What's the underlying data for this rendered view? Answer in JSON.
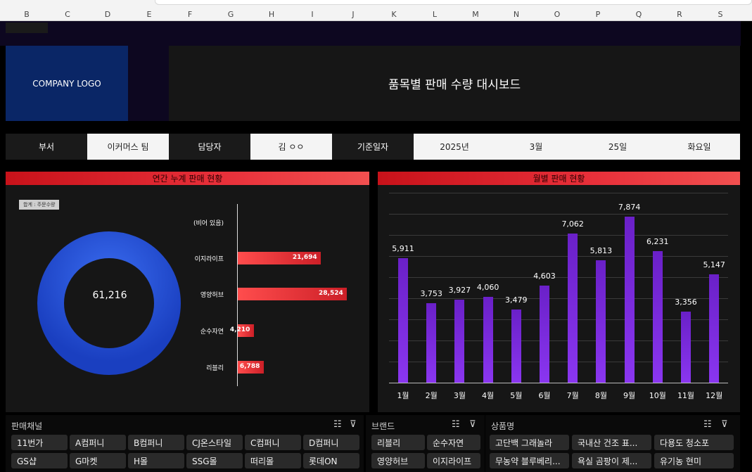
{
  "columns": [
    "B",
    "C",
    "D",
    "E",
    "F",
    "G",
    "H",
    "I",
    "J",
    "K",
    "L",
    "M",
    "N",
    "O",
    "P",
    "Q",
    "R",
    "S"
  ],
  "logo": "COMPANY LOGO",
  "title": "품목별 판매 수량 대시보드",
  "info": {
    "dept_label": "부서",
    "dept_value": "이커머스 팀",
    "owner_label": "담당자",
    "owner_value": "김 ㅇㅇ",
    "date_label": "기준일자",
    "year": "2025년",
    "month": "3월",
    "day": "25일",
    "weekday": "화요일"
  },
  "left_panel": {
    "header": "연간 누계 판매 현황",
    "legend_tag": "합계 : 주문수량",
    "total": "61,216"
  },
  "right_panel": {
    "header": "월별 판매 현황"
  },
  "chart_data": [
    {
      "type": "bar",
      "orientation": "horizontal",
      "categories": [
        "(비어 있음)",
        "이지라이프",
        "영양허브",
        "순수자연",
        "리블리"
      ],
      "values": [
        0,
        21694,
        28524,
        4210,
        6788
      ],
      "value_labels": [
        "",
        "21,694",
        "28,524",
        "4,210",
        "6,788"
      ],
      "color": "#e8303a"
    },
    {
      "type": "bar",
      "categories": [
        "1월",
        "2월",
        "3월",
        "4월",
        "5월",
        "6월",
        "7월",
        "8월",
        "9월",
        "10월",
        "11월",
        "12월"
      ],
      "values": [
        5911,
        3753,
        3927,
        4060,
        3479,
        4603,
        7062,
        5813,
        7874,
        6231,
        3356,
        5147
      ],
      "value_labels": [
        "5,911",
        "3,753",
        "3,927",
        "4,060",
        "3,479",
        "4,603",
        "7,062",
        "5,813",
        "7,874",
        "6,231",
        "3,356",
        "5,147"
      ],
      "ylim": [
        0,
        9000
      ],
      "grid": true,
      "color": "#8a36f0"
    }
  ],
  "slicers": {
    "channel": {
      "title": "판매채널",
      "items": [
        "11번가",
        "A컴퍼니",
        "B컴퍼니",
        "CJ온스타일",
        "C컴퍼니",
        "D컴퍼니",
        "GS샵",
        "G마켓",
        "H몰",
        "SSG몰",
        "떠리몰",
        "롯데ON"
      ]
    },
    "brand": {
      "title": "브랜드",
      "items": [
        "리블리",
        "순수자연",
        "영양허브",
        "이지라이프"
      ]
    },
    "product": {
      "title": "상품명",
      "items": [
        "고단백 그래놀라",
        "국내산 건조 표...",
        "다용도 청소포",
        "무농약 블루베리...",
        "욕실 곰팡이 제...",
        "유기농 현미"
      ]
    }
  },
  "icons": {
    "multiselect": "multi-select-icon",
    "clearfilter": "clear-filter-icon"
  }
}
